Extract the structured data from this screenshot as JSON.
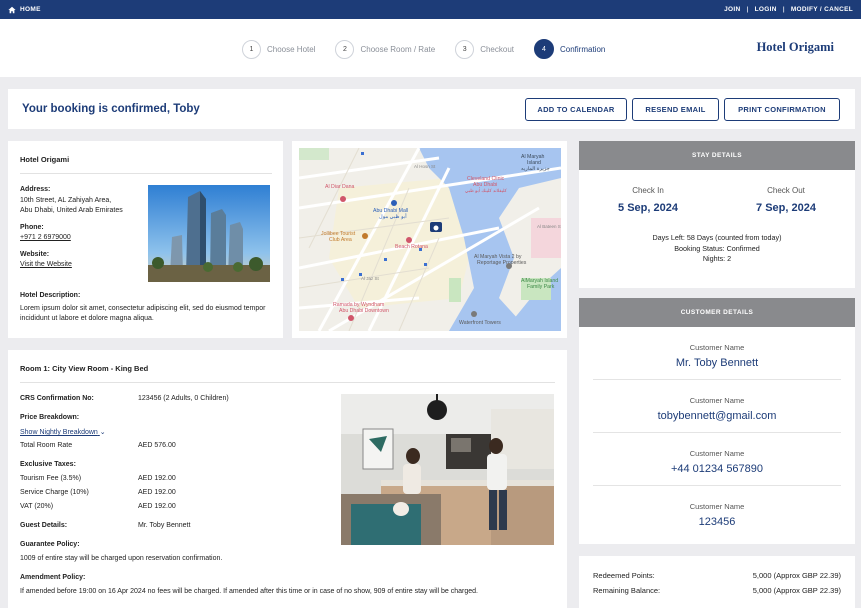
{
  "topbar": {
    "home_label": "HOME",
    "links": [
      "JOIN",
      "LOGIN",
      "MODIFY / CANCEL"
    ]
  },
  "steps": [
    {
      "num": "1",
      "label": "Choose Hotel",
      "active": false
    },
    {
      "num": "2",
      "label": "Choose Room / Rate",
      "active": false
    },
    {
      "num": "3",
      "label": "Checkout",
      "active": false
    },
    {
      "num": "4",
      "label": "Confirmation",
      "active": true
    }
  ],
  "brand": "Hotel Origami",
  "confirmation": {
    "title": "Your booking is confirmed, Toby",
    "buttons": {
      "calendar": "ADD TO CALENDAR",
      "email": "RESEND EMAIL",
      "print": "PRINT CONFIRMATION"
    }
  },
  "hotel": {
    "name": "Hotel Origami",
    "address_label": "Address:",
    "address_line1": "10th Street, AL Zahiyah Area,",
    "address_line2": "Abu Dhabi, United Arab Emirates",
    "phone_label": "Phone:",
    "phone": "+971 2 6979000",
    "website_label": "Website:",
    "website_link": "Visit the Website",
    "description_label": "Hotel Description:",
    "description": "Lorem ipsum dolor sit amet, consectetur adipiscing elit, sed do eiusmod tempor incididunt ut labore et dolore magna aliqua."
  },
  "map": {
    "labels": [
      "Al Maryah Island",
      "جزيرة الماريه",
      "Al Diar Dana",
      "Cleveland Clinic Abu Dhabi",
      "كليفلاند كلينك أبو ظبي",
      "Abu Dhabi Mall",
      "أبو ظبي مول",
      "Jollibee Tourist Club Area",
      "Beach Rotana",
      "Al Maryah Vista 2 by Reportage Properties",
      "AlMaryah Island Family Park",
      "Ramada by Wyndham Abu Dhabi Downtown",
      "Waterfront Towers",
      "Al Hosn St",
      "Al Bateen St",
      "Al Jaz St"
    ]
  },
  "stay": {
    "header": "STAY DETAILS",
    "check_in_label": "Check In",
    "check_in": "5 Sep, 2024",
    "check_out_label": "Check Out",
    "check_out": "7 Sep, 2024",
    "days_left": "Days Left: 58 Days (counted from today)",
    "status": "Booking Status: Confirmed",
    "nights": "Nights: 2"
  },
  "customer": {
    "header": "CUSTOMER DETAILS",
    "items": [
      {
        "label": "Customer Name",
        "value": "Mr. Toby Bennett"
      },
      {
        "label": "Customer Name",
        "value": "tobybennett@gmail.com"
      },
      {
        "label": "Customer Name",
        "value": "+44 01234 567890"
      },
      {
        "label": "Customer Name",
        "value": "123456"
      }
    ]
  },
  "room": {
    "title": "Room 1: City View Room - King Bed",
    "crs_label": "CRS Confirmation No:",
    "crs_value": "123456 (2 Adults, 0 Children)",
    "price_label": "Price Breakdown:",
    "nightly_link": "Show Nightly Breakdown",
    "total_label": "Total Room Rate",
    "total_value": "AED 576.00",
    "taxes_label": "Exclusive Taxes:",
    "tourism_label": "Tourism Fee (3.5%)",
    "tourism_value": "AED 192.00",
    "service_label": "Service Charge (10%)",
    "service_value": "AED 192.00",
    "vat_label": "VAT (20%)",
    "vat_value": "AED 192.00",
    "guest_label": "Guest Details:",
    "guest_value": "Mr. Toby Bennett",
    "guarantee_label": "Guarantee Policy:",
    "guarantee_text": "1009 of entire stay will be charged upon reservation confirmation.",
    "amendment_label": "Amendment Policy:",
    "amendment_text": "If amended before 19:00 on 16 Apr 2024 no fees will be charged. If amended after this time or in case of no show, 909 of entire stay will be charged."
  },
  "points": {
    "redeemed_label": "Redeemed Points:",
    "redeemed_value": "5,000 (Approx GBP 22.39)",
    "remaining_label": "Remaining Balance:",
    "remaining_value": "5,000 (Approx GBP 22.39)"
  },
  "colors": {
    "brand_navy": "#1d3c78",
    "panel_header_gray": "#898a8d",
    "page_bg": "#ececef"
  }
}
